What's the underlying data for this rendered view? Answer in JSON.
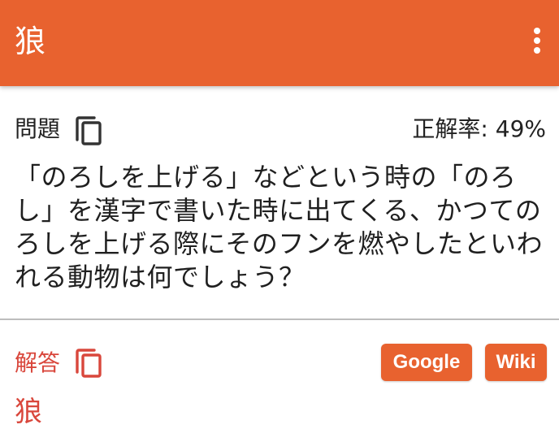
{
  "app_bar": {
    "title": "狼",
    "menu_icon": "more-vert-icon"
  },
  "question": {
    "label": "問題",
    "copy_icon": "copy-icon",
    "correct_rate": "正解率: 49%",
    "text": "「のろしを上げる」などという時の「のろし」を漢字で書いた時に出てくる、かつてのろしを上げる際にそのフンを燃やしたといわれる動物は何でしょう？"
  },
  "answer": {
    "label": "解答",
    "copy_icon": "copy-icon",
    "value": "狼",
    "buttons": {
      "google": "Google",
      "wiki": "Wiki"
    }
  },
  "colors": {
    "accent": "#e8622f",
    "answer_red": "#d9473c"
  }
}
